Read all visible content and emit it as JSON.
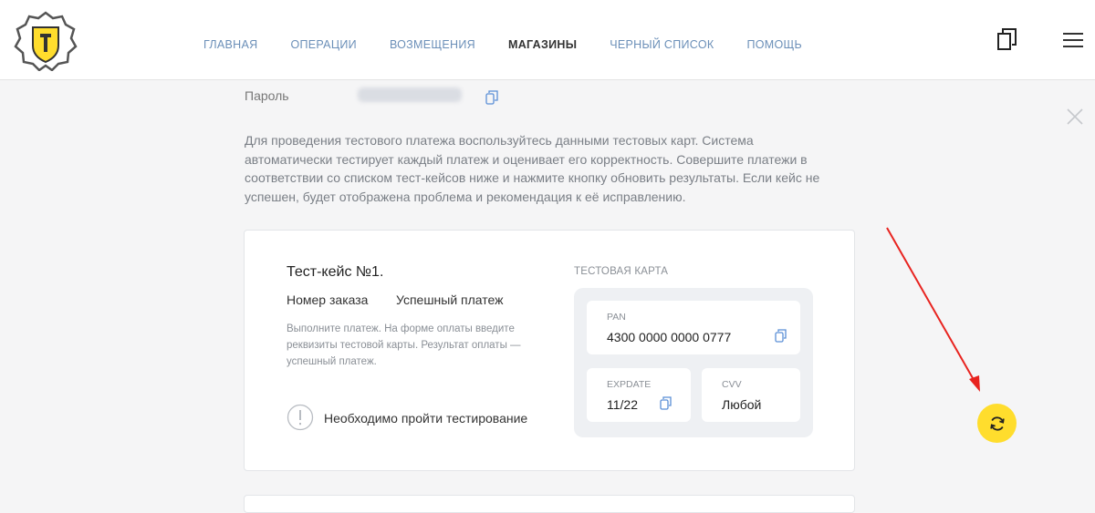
{
  "nav": {
    "items": [
      "ГЛАВНАЯ",
      "ОПЕРАЦИИ",
      "ВОЗМЕЩЕНИЯ",
      "МАГАЗИНЫ",
      "ЧЕРНЫЙ СПИСОК",
      "ПОМОЩЬ"
    ],
    "active_index": 3
  },
  "password": {
    "label": "Пароль"
  },
  "description": "Для проведения тестового платежа воспользуйтесь данными тестовых карт. Система автоматически тестирует каждый платеж и оценивает его корректность. Совершите платежи в соответствии со списком тест-кейсов ниже и нажмите кнопку обновить результаты. Если кейс не успешен, будет отображена проблема и рекомендация к её исправлению.",
  "test_case": {
    "title": "Тест-кейс №1.",
    "order_label": "Номер заказа",
    "order_value": "Успешный платеж",
    "instructions": "Выполните платеж. На форме оплаты введите реквизиты тестовой карты. Результат оплаты — успешный платеж.",
    "status_text": "Необходимо пройти тестирование",
    "card": {
      "label": "ТЕСТОВАЯ КАРТА",
      "pan_label": "PAN",
      "pan_value": "4300 0000 0000 0777",
      "exp_label": "EXPDATE",
      "exp_value": "11/22",
      "cvv_label": "CVV",
      "cvv_value": "Любой"
    }
  },
  "colors": {
    "accent_yellow": "#ffdd2d",
    "link_blue": "#6b8fb8",
    "annotation_arrow": "#e8231f"
  },
  "icons": [
    "tinkoff-logo-icon",
    "copy-icon",
    "menu-icon",
    "close-icon",
    "refresh-icon",
    "warning-icon"
  ]
}
